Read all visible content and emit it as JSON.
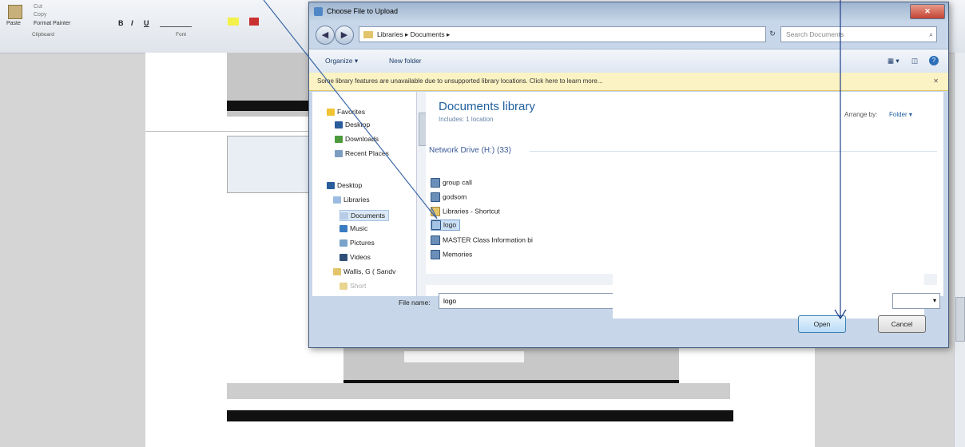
{
  "ribbon": {
    "paste": "Paste",
    "cut": "Cut",
    "copy": "Copy",
    "format_painter": "Format Painter",
    "clipboard_group": "Clipboard",
    "font_group": "Font",
    "bold": "B",
    "italic": "I",
    "underline": "U"
  },
  "dialog": {
    "title": "Choose File to Upload",
    "address": "Libraries ▸ Documents ▸",
    "search_placeholder": "Search Documents",
    "organize": "Organize ▾",
    "new_folder": "New folder",
    "info_bar": "Some library features are unavailable due to unsupported library locations. Click here to learn more...",
    "nav": [
      {
        "label": "Favorites",
        "icon": "star-icon"
      },
      {
        "label": "Desktop",
        "icon": "desktop-icon"
      },
      {
        "label": "Downloads",
        "icon": "downloads-icon"
      },
      {
        "label": "Recent Places",
        "icon": "recent-places-icon"
      },
      {
        "label": "Desktop",
        "icon": "desktop-icon"
      },
      {
        "label": "Libraries",
        "icon": "libraries-icon"
      },
      {
        "label": "Documents",
        "icon": "documents-icon"
      },
      {
        "label": "Music",
        "icon": "music-icon"
      },
      {
        "label": "Pictures",
        "icon": "pictures-icon"
      },
      {
        "label": "Videos",
        "icon": "videos-icon"
      },
      {
        "label": "Wallis, G  ( Sandv",
        "icon": "user-folder-icon"
      },
      {
        "label": "Short",
        "icon": "folder-icon"
      }
    ],
    "library_title": "Documents library",
    "library_includes": "Includes: 1 location",
    "arrange_by": "Arrange by:",
    "arrange_value": "Folder ▾",
    "group_title": "Network Drive (H:) (33)",
    "files": [
      "group call",
      "godsom",
      "Libraries - Shortcut",
      "logo",
      "MASTER Class Information bi",
      "Memories"
    ],
    "selected_file": "logo",
    "filename_label": "File name:",
    "filename_value": "logo",
    "open_button": "Open",
    "cancel_button": "Cancel"
  }
}
